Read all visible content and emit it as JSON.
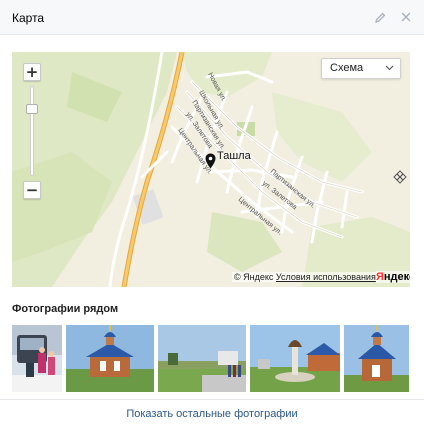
{
  "header": {
    "title": "Карта",
    "edit_icon": "pencil-icon",
    "close_icon": "close-icon"
  },
  "map": {
    "layer_selected": "Схема",
    "place_label": "Ташла",
    "streets": [
      "Новая ул.",
      "Школьная ул.",
      "Партизанская ул.",
      "ул. Залетова",
      "Центральная ул.",
      "Партизанская ул.",
      "ул. Залетова",
      "Центральная ул."
    ],
    "attribution_prefix": "© Яндекс",
    "attribution_terms": "Условия использования",
    "logo_first": "Я",
    "logo_rest": "ндекс",
    "zoom_in": "+",
    "zoom_out": "−"
  },
  "photos": {
    "title": "Фотографии рядом",
    "count_visible": 5
  },
  "footer": {
    "more_label": "Показать остальные фотографии"
  },
  "colors": {
    "header_bg": "#f7f8fa",
    "link": "#2a5885",
    "map_land": "#f2efe0",
    "map_green": "#d6e4b8",
    "road_main": "#f4b850"
  }
}
